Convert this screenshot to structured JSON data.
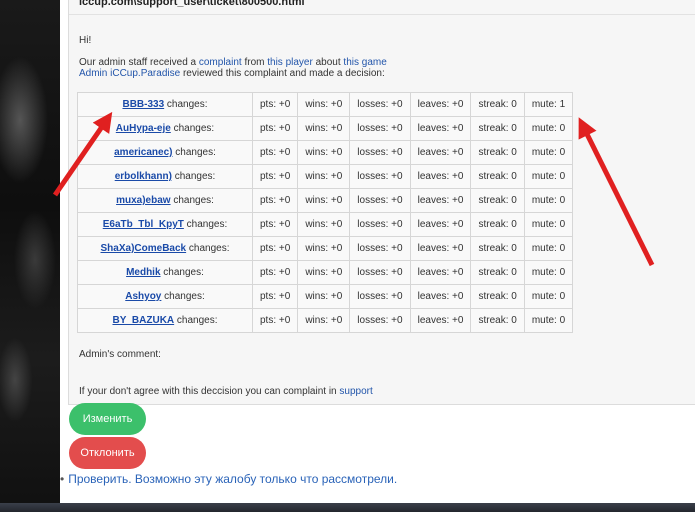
{
  "header": {
    "url": "iccup.com\\support_user\\ticket\\800500.html"
  },
  "email": {
    "greeting": "Hi!",
    "line1": {
      "pre": "Our admin staff received a ",
      "link1": "complaint",
      "mid": " from ",
      "link2": "this player",
      "mid2": " about ",
      "link3": "this game"
    },
    "line2": {
      "admin": "Admin iCCup.Paradise",
      "rest": " reviewed this complaint and made a decision:"
    },
    "changes_suffix": " changes:",
    "rows": [
      {
        "nick": "BBB-333",
        "pts": "pts: +0",
        "wins": "wins: +0",
        "losses": "losses: +0",
        "leaves": "leaves: +0",
        "streak": "streak: 0",
        "mute": "mute: 1"
      },
      {
        "nick": "AuHypa-eje",
        "pts": "pts: +0",
        "wins": "wins: +0",
        "losses": "losses: +0",
        "leaves": "leaves: +0",
        "streak": "streak: 0",
        "mute": "mute: 0"
      },
      {
        "nick": "americanec)",
        "pts": "pts: +0",
        "wins": "wins: +0",
        "losses": "losses: +0",
        "leaves": "leaves: +0",
        "streak": "streak: 0",
        "mute": "mute: 0"
      },
      {
        "nick": "erbolkhann)",
        "pts": "pts: +0",
        "wins": "wins: +0",
        "losses": "losses: +0",
        "leaves": "leaves: +0",
        "streak": "streak: 0",
        "mute": "mute: 0"
      },
      {
        "nick": "muxa)ebaw",
        "pts": "pts: +0",
        "wins": "wins: +0",
        "losses": "losses: +0",
        "leaves": "leaves: +0",
        "streak": "streak: 0",
        "mute": "mute: 0"
      },
      {
        "nick": "E6aTb_Tbl_KpyT",
        "pts": "pts: +0",
        "wins": "wins: +0",
        "losses": "losses: +0",
        "leaves": "leaves: +0",
        "streak": "streak: 0",
        "mute": "mute: 0"
      },
      {
        "nick": "ShaXa)ComeBack",
        "pts": "pts: +0",
        "wins": "wins: +0",
        "losses": "losses: +0",
        "leaves": "leaves: +0",
        "streak": "streak: 0",
        "mute": "mute: 0"
      },
      {
        "nick": "Medhik",
        "pts": "pts: +0",
        "wins": "wins: +0",
        "losses": "losses: +0",
        "leaves": "leaves: +0",
        "streak": "streak: 0",
        "mute": "mute: 0"
      },
      {
        "nick": "Ashyoy",
        "pts": "pts: +0",
        "wins": "wins: +0",
        "losses": "losses: +0",
        "leaves": "leaves: +0",
        "streak": "streak: 0",
        "mute": "mute: 0"
      },
      {
        "nick": "BY_BAZUKA",
        "pts": "pts: +0",
        "wins": "wins: +0",
        "losses": "losses: +0",
        "leaves": "leaves: +0",
        "streak": "streak: 0",
        "mute": "mute: 0"
      }
    ],
    "admin_comment": "Admin's comment:",
    "footer": {
      "text": "If your don't agree with this deccision you can complaint in ",
      "link": "support"
    }
  },
  "actions": {
    "edit_label": "Изменить",
    "reject_label": "Отклонить",
    "check_link": "Проверить. Возможно эту жалобу только что рассмотрели."
  },
  "colors": {
    "arrow": "#e02020",
    "edit": "#3cc06b",
    "reject": "#e34d4d",
    "link": "#2255aa"
  }
}
